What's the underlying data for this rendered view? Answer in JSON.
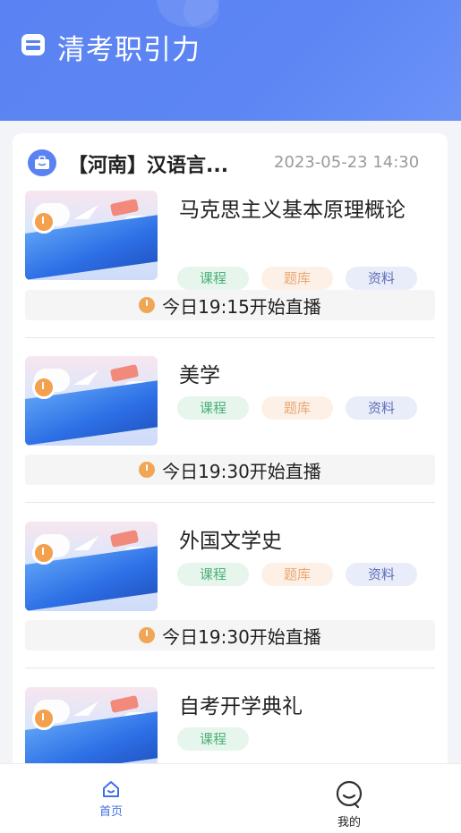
{
  "app": {
    "title": "清考职引力",
    "icon": "app-store-icon",
    "accent": "#5b82f2"
  },
  "group": {
    "title": "【河南】汉语言...",
    "time": "2023-05-23 14:30",
    "icon": "briefcase-icon"
  },
  "courses": [
    {
      "title": "马克思主义基本原理概论",
      "tags": [
        "课程",
        "题库",
        "资料"
      ],
      "live": "今日19:15开始直播"
    },
    {
      "title": "美学",
      "tags": [
        "课程",
        "题库",
        "资料"
      ],
      "live": "今日19:30开始直播"
    },
    {
      "title": "外国文学史",
      "tags": [
        "课程",
        "题库",
        "资料"
      ],
      "live": "今日19:30开始直播"
    },
    {
      "title": "自考开学典礼",
      "tags": [
        "课程"
      ]
    }
  ],
  "tabbar": {
    "home": {
      "label": "首页",
      "icon": "home-icon",
      "active": true
    },
    "mine": {
      "label": "我的",
      "icon": "user-icon",
      "active": false
    }
  }
}
